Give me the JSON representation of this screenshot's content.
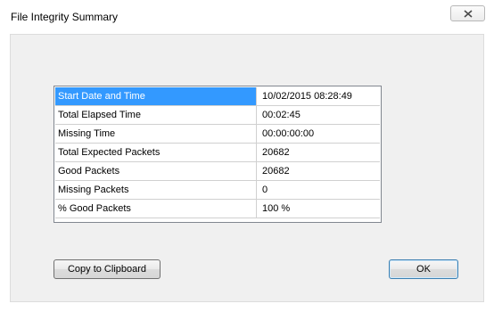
{
  "window": {
    "title": "File Integrity Summary"
  },
  "summary": {
    "rows": [
      {
        "label": "Start Date and Time",
        "value": "10/02/2015 08:28:49"
      },
      {
        "label": "Total Elapsed Time",
        "value": "00:02:45"
      },
      {
        "label": "Missing Time",
        "value": "00:00:00:00"
      },
      {
        "label": "Total Expected Packets",
        "value": "20682"
      },
      {
        "label": "Good Packets",
        "value": "20682"
      },
      {
        "label": "Missing Packets",
        "value": "0"
      },
      {
        "label": "% Good Packets",
        "value": "100 %"
      }
    ],
    "selected_row": "Start Date and Time"
  },
  "buttons": {
    "copy_label": "Copy to Clipboard",
    "ok_label": "OK"
  },
  "colors": {
    "selection": "#3399ff",
    "client_background": "#f0f0f0"
  },
  "icons": {
    "close": "close-icon"
  }
}
